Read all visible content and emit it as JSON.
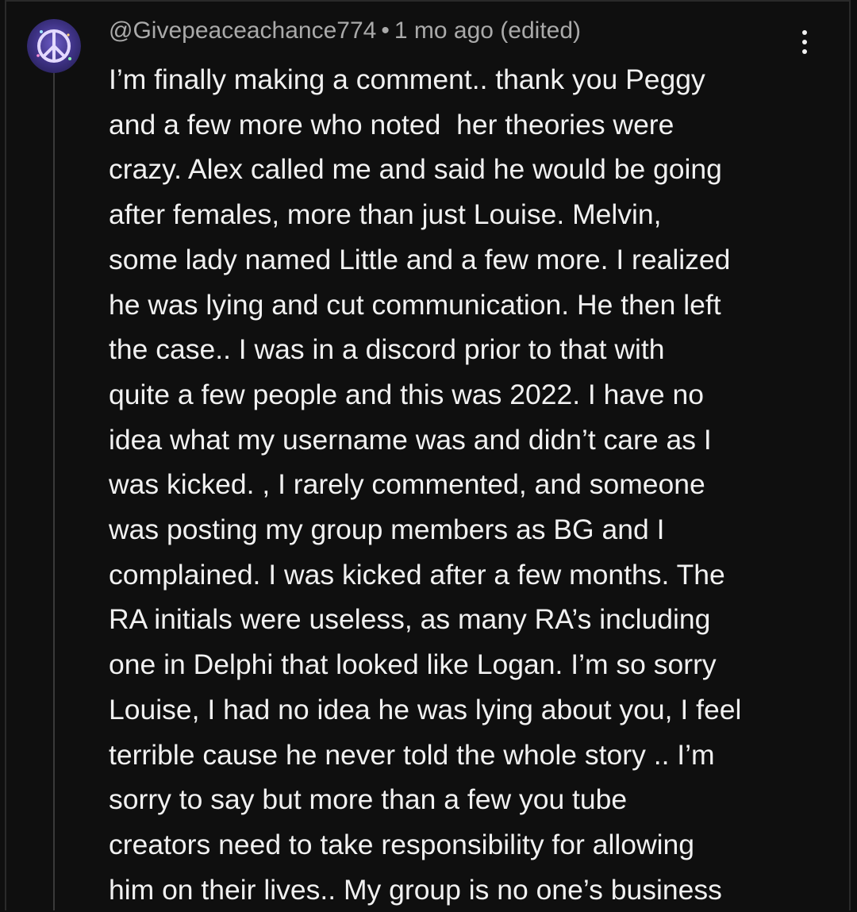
{
  "comment": {
    "username": "@Givepeaceachance774",
    "separator": "•",
    "timestamp": "1 mo ago (edited)",
    "avatar_icon": "peace-sign-icon",
    "more_icon": "more-vertical-icon",
    "lines": [
      "I’m finally making a comment.. thank you Peggy",
      "and a few more who noted  her theories were",
      "crazy. Alex called me and said he would be going",
      "after females, more than just Louise. Melvin,",
      "some lady named Little and a few more. I realized",
      "he was lying and cut communication. He then left",
      "the case.. I was in a discord prior to that with",
      "quite a few people and this was 2022. I have no",
      "idea what my username was and didn’t care as I",
      "was kicked. , I rarely commented, and someone",
      "was posting my group members as BG and I",
      "complained. I was kicked after a few months. The",
      "RA initials were useless, as many RA’s including",
      "one in Delphi that looked like Logan. I’m so sorry",
      "Louise, I had no idea he was lying about you, I feel",
      "terrible cause he never told the whole story .. I’m",
      "sorry to say but more than a few you tube",
      "creators need to take responsibility for allowing",
      "him on their lives.. My group is no one’s business"
    ]
  },
  "colors": {
    "background": "#0f0f0f",
    "text_primary": "#f1f1f1",
    "text_secondary": "#aaaaaa",
    "thread_line": "#3a3a3a",
    "avatar_bg": "#4a3c8c",
    "avatar_symbol": "#d8c8ff"
  }
}
